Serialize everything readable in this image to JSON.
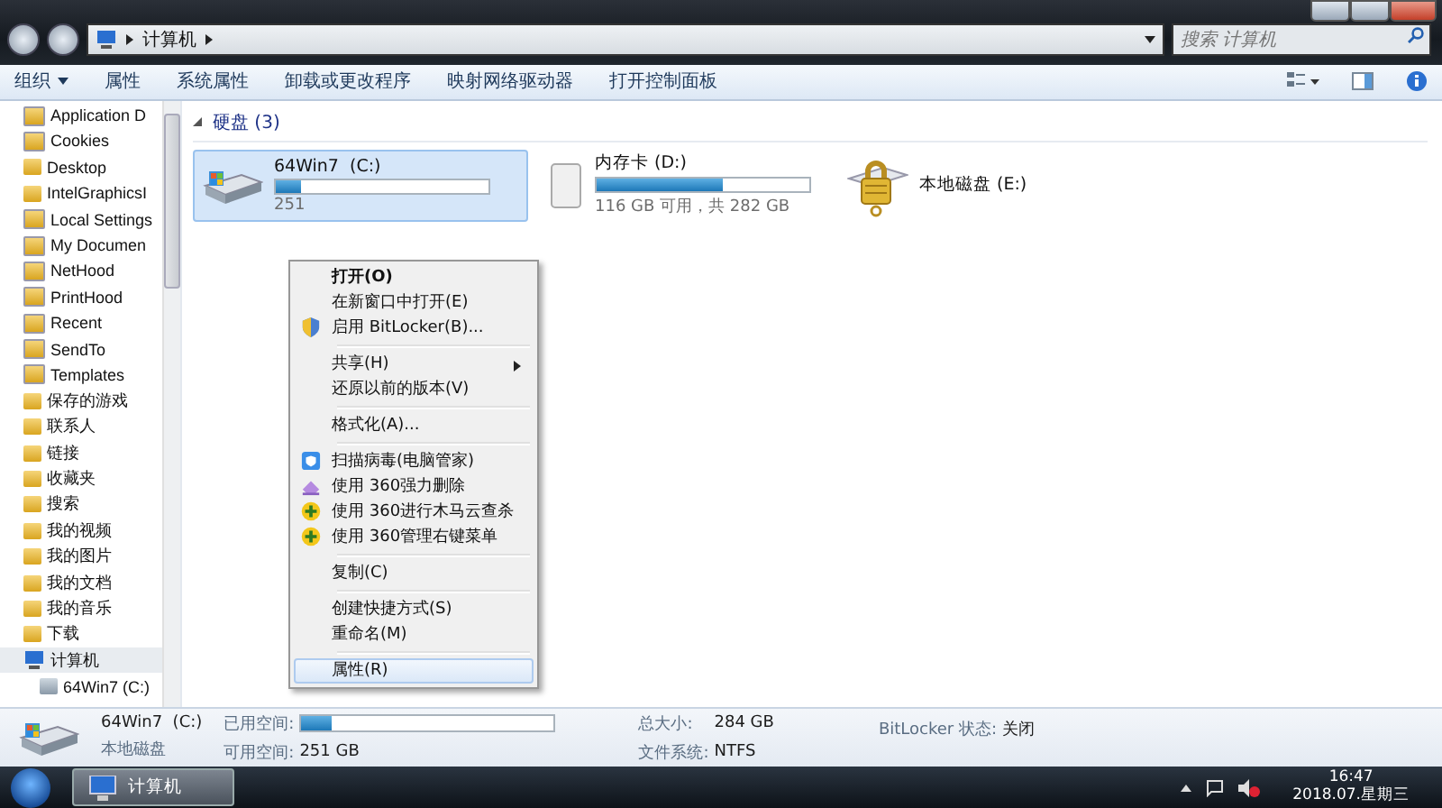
{
  "window": {
    "address": [
      "计算机"
    ],
    "search": {
      "placeholder": "搜索 计算机"
    }
  },
  "toolbar": {
    "buttons": [
      {
        "label": "组织",
        "dropdown": true
      },
      {
        "label": "属性",
        "dropdown": false
      },
      {
        "label": "系统属性",
        "dropdown": false
      },
      {
        "label": "卸载或更改程序",
        "dropdown": false
      },
      {
        "label": "映射网络驱动器",
        "dropdown": false
      },
      {
        "label": "打开控制面板",
        "dropdown": false
      }
    ]
  },
  "sidebar": {
    "items": [
      {
        "label": "Application D",
        "kind": "link",
        "selected": false
      },
      {
        "label": "Cookies",
        "kind": "link",
        "selected": false
      },
      {
        "label": "Desktop",
        "kind": "folder",
        "selected": false
      },
      {
        "label": "IntelGraphicsI",
        "kind": "folder",
        "selected": false
      },
      {
        "label": "Local Settings",
        "kind": "link",
        "selected": false
      },
      {
        "label": "My Documen",
        "kind": "link",
        "selected": false
      },
      {
        "label": "NetHood",
        "kind": "link",
        "selected": false
      },
      {
        "label": "PrintHood",
        "kind": "link",
        "selected": false
      },
      {
        "label": "Recent",
        "kind": "link",
        "selected": false
      },
      {
        "label": "SendTo",
        "kind": "link",
        "selected": false
      },
      {
        "label": "Templates",
        "kind": "link",
        "selected": false
      },
      {
        "label": "保存的游戏",
        "kind": "folder",
        "selected": false
      },
      {
        "label": "联系人",
        "kind": "folder",
        "selected": false
      },
      {
        "label": "链接",
        "kind": "folder",
        "selected": false
      },
      {
        "label": "收藏夹",
        "kind": "folder",
        "selected": false
      },
      {
        "label": "搜索",
        "kind": "folder",
        "selected": false
      },
      {
        "label": "我的视频",
        "kind": "folder",
        "selected": false
      },
      {
        "label": "我的图片",
        "kind": "folder",
        "selected": false
      },
      {
        "label": "我的文档",
        "kind": "folder",
        "selected": false
      },
      {
        "label": "我的音乐",
        "kind": "folder",
        "selected": false
      },
      {
        "label": "下载",
        "kind": "folder",
        "selected": false
      },
      {
        "label": "计算机",
        "kind": "computer",
        "selected": true,
        "children": [
          {
            "label": "64Win7  (C:)",
            "kind": "drive",
            "selected": false
          }
        ]
      }
    ]
  },
  "content": {
    "group": "硬盘 (3)",
    "drives": [
      {
        "name": "64Win7  (C:)",
        "kind": "system",
        "selected": true,
        "level": 0.12,
        "free": "251"
      },
      {
        "name": "内存卡 (D:)",
        "kind": "removable",
        "selected": false,
        "level": 0.59,
        "free": "116 GB 可用，共 282 GB"
      },
      {
        "name": "本地磁盘 (E:)",
        "kind": "locked",
        "selected": false
      }
    ]
  },
  "context_menu": {
    "items": [
      {
        "kind": "item",
        "label": "打开(O)",
        "default": true,
        "selected": false
      },
      {
        "kind": "item",
        "label": "在新窗口中打开(E)",
        "default": false,
        "selected": false
      },
      {
        "kind": "shield",
        "label": "启用 BitLocker(B)...",
        "default": false,
        "selected": false
      },
      {
        "kind": "separator"
      },
      {
        "kind": "submenu",
        "label": "共享(H)",
        "default": false,
        "selected": false
      },
      {
        "kind": "item",
        "label": "还原以前的版本(V)",
        "default": false,
        "selected": false
      },
      {
        "kind": "separator"
      },
      {
        "kind": "item",
        "label": "格式化(A)...",
        "default": false,
        "selected": false
      },
      {
        "kind": "separator"
      },
      {
        "kind": "scan",
        "label": "扫描病毒(电脑管家)",
        "default": false,
        "selected": false
      },
      {
        "kind": "eraser",
        "label": "使用 360强力删除",
        "default": false,
        "selected": false
      },
      {
        "kind": "plus",
        "label": "使用 360进行木马云查杀",
        "default": false,
        "selected": false
      },
      {
        "kind": "plus",
        "label": "使用 360管理右键菜单",
        "default": false,
        "selected": false
      },
      {
        "kind": "separator"
      },
      {
        "kind": "item",
        "label": "复制(C)",
        "default": false,
        "selected": false
      },
      {
        "kind": "separator"
      },
      {
        "kind": "item",
        "label": "创建快捷方式(S)",
        "default": false,
        "selected": false
      },
      {
        "kind": "item",
        "label": "重命名(M)",
        "default": false,
        "selected": false
      },
      {
        "kind": "separator"
      },
      {
        "kind": "item",
        "label": "属性(R)",
        "default": false,
        "selected": true
      }
    ]
  },
  "details": {
    "name": "64Win7  (C:)",
    "type": "本地磁盘",
    "used_label": "已用空间:",
    "level": 0.12,
    "free_label": "可用空间:",
    "free": "251 GB",
    "total_label": "总大小:",
    "total": "284 GB",
    "fs_label": "文件系统:",
    "fs": "NTFS",
    "bitlocker_label": "BitLocker 状态:",
    "bitlocker": "关闭"
  },
  "taskbar": {
    "buttons": [
      {
        "label": "计算机",
        "selected": true
      }
    ],
    "time": "16:47",
    "date": "2018.07.星期三"
  }
}
